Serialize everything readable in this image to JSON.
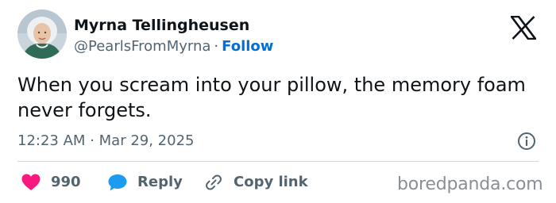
{
  "author": {
    "name": "Myrna Tellingheusen",
    "handle": "@PearlsFromMyrna",
    "separator": "·",
    "follow_label": "Follow",
    "avatar_icon": "profile-photo-icon"
  },
  "post": {
    "text": "When you scream into your pillow, the memory foam never forgets.",
    "time": "12:23 AM",
    "date_separator": "·",
    "date": "Mar 29, 2025"
  },
  "actions": {
    "like_count": "990",
    "reply_label": "Reply",
    "copy_link_label": "Copy link"
  },
  "watermark": "boredpanda.com",
  "icons": {
    "brand": "x-logo-icon",
    "info": "info-icon",
    "like": "heart-icon",
    "reply": "speech-bubble-icon",
    "copy": "link-icon"
  },
  "colors": {
    "like": "#f91880",
    "reply": "#1d9bf0",
    "follow": "#006fd6",
    "muted": "#536471"
  }
}
